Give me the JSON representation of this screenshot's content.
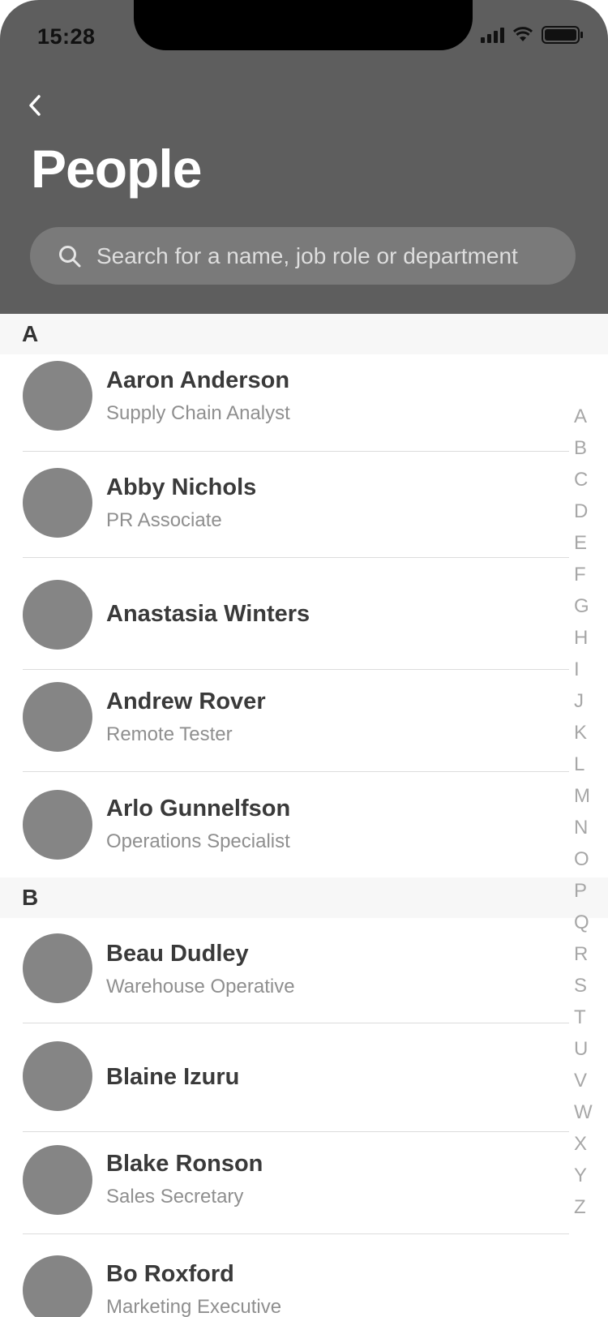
{
  "status_bar": {
    "time": "15:28"
  },
  "header": {
    "title": "People",
    "back_icon": "chevron-left-icon"
  },
  "search": {
    "placeholder": "Search for a name, job role or department",
    "icon": "search-icon"
  },
  "colors": {
    "header_bg": "#5e5e5e",
    "search_bg": "#7a7a7a",
    "avatar": "#858585",
    "section_bg": "#f7f7f7"
  },
  "sections": [
    {
      "letter": "A",
      "people": [
        {
          "name": "Aaron Anderson",
          "role": "Supply Chain Analyst"
        },
        {
          "name": "Abby Nichols",
          "role": "PR Associate"
        },
        {
          "name": "Anastasia Winters",
          "role": ""
        },
        {
          "name": "Andrew Rover",
          "role": "Remote Tester"
        },
        {
          "name": "Arlo Gunnelfson",
          "role": "Operations Specialist"
        }
      ]
    },
    {
      "letter": "B",
      "people": [
        {
          "name": "Beau Dudley",
          "role": "Warehouse Operative"
        },
        {
          "name": "Blaine Izuru",
          "role": ""
        },
        {
          "name": "Blake Ronson",
          "role": "Sales Secretary"
        },
        {
          "name": "Bo Roxford",
          "role": "Marketing Executive"
        }
      ]
    }
  ],
  "alphabet_index": [
    "A",
    "B",
    "C",
    "D",
    "E",
    "F",
    "G",
    "H",
    "I",
    "J",
    "K",
    "L",
    "M",
    "N",
    "O",
    "P",
    "Q",
    "R",
    "S",
    "T",
    "U",
    "V",
    "W",
    "X",
    "Y",
    "Z"
  ]
}
